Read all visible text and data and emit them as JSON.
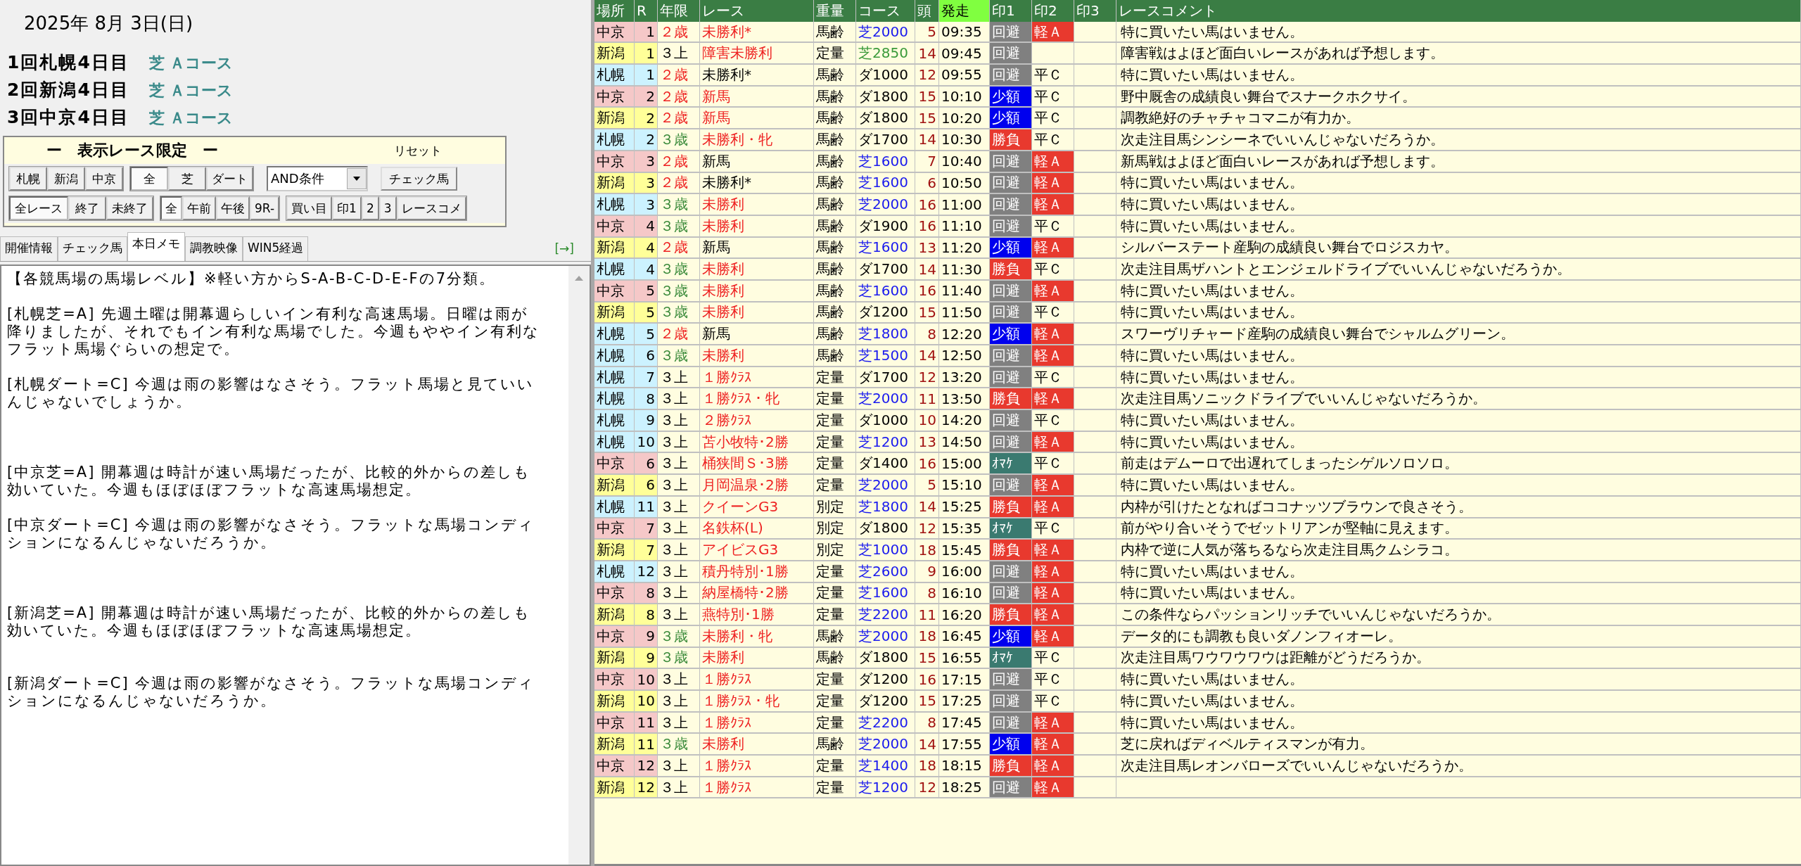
{
  "date": "2025年 8月 3日(日)",
  "meetings": [
    {
      "name": "1回札幌4日目",
      "course": "芝 Ａコース"
    },
    {
      "name": "2回新潟4日目",
      "course": "芝 Ａコース"
    },
    {
      "name": "3回中京4日目",
      "course": "芝 Ａコース"
    }
  ],
  "filter": {
    "title": "ー　表示レース限定　ー",
    "reset": "リセット",
    "venues": [
      {
        "label": "札幌",
        "selected": false
      },
      {
        "label": "新潟",
        "selected": false
      },
      {
        "label": "中京",
        "selected": false
      }
    ],
    "surfaces": [
      {
        "label": "全",
        "selected": true
      },
      {
        "label": "芝",
        "selected": false
      },
      {
        "label": "ダート",
        "selected": false
      }
    ],
    "condition": {
      "value": "AND条件"
    },
    "check_button": "チェック馬",
    "status": [
      {
        "label": "全レース",
        "selected": true
      },
      {
        "label": "終了",
        "selected": false
      },
      {
        "label": "未終了",
        "selected": false
      }
    ],
    "times": [
      {
        "label": "全",
        "selected": true
      },
      {
        "label": "午前",
        "selected": false
      },
      {
        "label": "午後",
        "selected": false
      },
      {
        "label": "9R-",
        "selected": false
      }
    ],
    "actions": [
      "買い目",
      "印1",
      "2",
      "3",
      "レースコメ"
    ]
  },
  "tabs": [
    {
      "label": "開催情報",
      "selected": false
    },
    {
      "label": "チェック馬",
      "selected": false
    },
    {
      "label": "本日メモ",
      "selected": true
    },
    {
      "label": "調教映像",
      "selected": false
    },
    {
      "label": "WIN5経過",
      "selected": false
    }
  ],
  "expand_link": "[→]",
  "memo": "【各競馬場の馬場レベル】※軽い方からS-A-B-C-D-E-Fの7分類。\n\n[札幌芝=A] 先週土曜は開幕週らしいイン有利な高速馬場。日曜は雨が降りましたが、それでもイン有利な馬場でした。今週もややイン有利なフラット馬場ぐらいの想定で。\n\n[札幌ダート=C] 今週は雨の影響はなさそう。フラット馬場と見ていいんじゃないでしょうか。\n\n\n\n[中京芝=A] 開幕週は時計が速い馬場だったが、比較的外からの差しも効いていた。今週もほぼほぼフラットな高速馬場想定。\n\n[中京ダート=C] 今週は雨の影響がなさそう。フラットな馬場コンディションになるんじゃないだろうか。\n\n\n\n[新潟芝=A] 開幕週は時計が速い馬場だったが、比較的外からの差しも効いていた。今週もほぼほぼフラットな高速馬場想定。\n\n\n[新潟ダート=C] 今週は雨の影響がなさそう。フラットな馬場コンディションになるんじゃないだろうか。",
  "table": {
    "columns": [
      "場所",
      "R",
      "年限",
      "レース",
      "重量",
      "コース",
      "頭",
      "発走",
      "印1",
      "印2",
      "印3",
      "レースコメント"
    ],
    "rows": [
      {
        "venue": "中京",
        "color": "#f5c8c8",
        "r": "1",
        "age": {
          "text": "２歳",
          "color": "#ee2222"
        },
        "race": {
          "text": "未勝利*",
          "color": "#ee2222"
        },
        "weight": "馬齢",
        "course": {
          "text": "芝2000",
          "color": "#1a1aee"
        },
        "heads": "5",
        "time": "09:35",
        "mark1": {
          "text": "回避",
          "color": "#808080"
        },
        "mark2": {
          "text": "軽Ａ",
          "color": "#e8392e"
        },
        "comment": "特に買いたい馬はいません。"
      },
      {
        "venue": "新潟",
        "color": "#ffff99",
        "r": "1",
        "age": {
          "text": "３上",
          "color": "#000000"
        },
        "race": {
          "text": "障害未勝利",
          "color": "#ee2222"
        },
        "weight": "定量",
        "course": {
          "text": "芝2850",
          "color": "#3a9a3a"
        },
        "heads": "14",
        "time": "09:45",
        "mark1": {
          "text": "回避",
          "color": "#808080"
        },
        "comment": "障害戦はよほど面白いレースがあれば予想します。"
      },
      {
        "venue": "札幌",
        "color": "#ccf2ff",
        "r": "1",
        "age": {
          "text": "２歳",
          "color": "#ee2222"
        },
        "race": {
          "text": "未勝利*",
          "color": "#000000"
        },
        "weight": "馬齢",
        "course": {
          "text": "ダ1000",
          "color": "#000000"
        },
        "heads": "12",
        "time": "09:55",
        "mark1": {
          "text": "回避",
          "color": "#808080"
        },
        "mark2": {
          "text": "平Ｃ"
        },
        "comment": "特に買いたい馬はいません。"
      },
      {
        "venue": "中京",
        "color": "#f5c8c8",
        "r": "2",
        "age": {
          "text": "２歳",
          "color": "#ee2222"
        },
        "race": {
          "text": "新馬",
          "color": "#ee2222"
        },
        "weight": "馬齢",
        "course": {
          "text": "ダ1800",
          "color": "#000000"
        },
        "heads": "15",
        "time": "10:10",
        "mark1": {
          "text": "少額",
          "color": "#0000ee"
        },
        "mark2": {
          "text": "平Ｃ"
        },
        "comment": "野中厩舎の成績良い舞台でスナークホクサイ。"
      },
      {
        "venue": "新潟",
        "color": "#ffff99",
        "r": "2",
        "age": {
          "text": "２歳",
          "color": "#ee2222"
        },
        "race": {
          "text": "新馬",
          "color": "#ee2222"
        },
        "weight": "馬齢",
        "course": {
          "text": "ダ1800",
          "color": "#000000"
        },
        "heads": "15",
        "time": "10:20",
        "mark1": {
          "text": "少額",
          "color": "#0000ee"
        },
        "mark2": {
          "text": "平Ｃ"
        },
        "comment": "調教絶好のチャチャコマニが有力か。"
      },
      {
        "venue": "札幌",
        "color": "#ccf2ff",
        "r": "2",
        "age": {
          "text": "３歳",
          "color": "#3a8a3a"
        },
        "race": {
          "text": "未勝利・牝",
          "color": "#ee2222"
        },
        "weight": "馬齢",
        "course": {
          "text": "ダ1700",
          "color": "#000000"
        },
        "heads": "14",
        "time": "10:30",
        "mark1": {
          "text": "勝負",
          "color": "#e8392e"
        },
        "mark2": {
          "text": "平Ｃ"
        },
        "comment": "次走注目馬シンシーネでいいんじゃないだろうか。"
      },
      {
        "venue": "中京",
        "color": "#f5c8c8",
        "r": "3",
        "age": {
          "text": "２歳",
          "color": "#ee2222"
        },
        "race": {
          "text": "新馬",
          "color": "#000000"
        },
        "weight": "馬齢",
        "course": {
          "text": "芝1600",
          "color": "#1a1aee"
        },
        "heads": "7",
        "time": "10:40",
        "mark1": {
          "text": "回避",
          "color": "#808080"
        },
        "mark2": {
          "text": "軽Ａ",
          "color": "#e8392e"
        },
        "comment": "新馬戦はよほど面白いレースがあれば予想します。"
      },
      {
        "venue": "新潟",
        "color": "#ffff99",
        "r": "3",
        "age": {
          "text": "２歳",
          "color": "#ee2222"
        },
        "race": {
          "text": "未勝利*",
          "color": "#000000"
        },
        "weight": "馬齢",
        "course": {
          "text": "芝1600",
          "color": "#1a1aee"
        },
        "heads": "6",
        "time": "10:50",
        "mark1": {
          "text": "回避",
          "color": "#808080"
        },
        "mark2": {
          "text": "軽Ａ",
          "color": "#e8392e"
        },
        "comment": "特に買いたい馬はいません。"
      },
      {
        "venue": "札幌",
        "color": "#ccf2ff",
        "r": "3",
        "age": {
          "text": "３歳",
          "color": "#3a8a3a"
        },
        "race": {
          "text": "未勝利",
          "color": "#ee2222"
        },
        "weight": "馬齢",
        "course": {
          "text": "芝2000",
          "color": "#1a1aee"
        },
        "heads": "16",
        "time": "11:00",
        "mark1": {
          "text": "回避",
          "color": "#808080"
        },
        "mark2": {
          "text": "軽Ａ",
          "color": "#e8392e"
        },
        "comment": "特に買いたい馬はいません。"
      },
      {
        "venue": "中京",
        "color": "#f5c8c8",
        "r": "4",
        "age": {
          "text": "３歳",
          "color": "#3a8a3a"
        },
        "race": {
          "text": "未勝利",
          "color": "#ee2222"
        },
        "weight": "馬齢",
        "course": {
          "text": "ダ1900",
          "color": "#000000"
        },
        "heads": "16",
        "time": "11:10",
        "mark1": {
          "text": "回避",
          "color": "#808080"
        },
        "mark2": {
          "text": "平Ｃ"
        },
        "comment": "特に買いたい馬はいません。"
      },
      {
        "venue": "新潟",
        "color": "#ffff99",
        "r": "4",
        "age": {
          "text": "２歳",
          "color": "#ee2222"
        },
        "race": {
          "text": "新馬",
          "color": "#000000"
        },
        "weight": "馬齢",
        "course": {
          "text": "芝1600",
          "color": "#1a1aee"
        },
        "heads": "13",
        "time": "11:20",
        "mark1": {
          "text": "少額",
          "color": "#0000ee"
        },
        "mark2": {
          "text": "軽Ａ",
          "color": "#e8392e"
        },
        "comment": "シルバーステート産駒の成績良い舞台でロジスカヤ。"
      },
      {
        "venue": "札幌",
        "color": "#ccf2ff",
        "r": "4",
        "age": {
          "text": "３歳",
          "color": "#3a8a3a"
        },
        "race": {
          "text": "未勝利",
          "color": "#ee2222"
        },
        "weight": "馬齢",
        "course": {
          "text": "ダ1700",
          "color": "#000000"
        },
        "heads": "14",
        "time": "11:30",
        "mark1": {
          "text": "勝負",
          "color": "#e8392e"
        },
        "mark2": {
          "text": "平Ｃ"
        },
        "comment": "次走注目馬ザハントとエンジェルドライブでいいんじゃないだろうか。"
      },
      {
        "venue": "中京",
        "color": "#f5c8c8",
        "r": "5",
        "age": {
          "text": "３歳",
          "color": "#3a8a3a"
        },
        "race": {
          "text": "未勝利",
          "color": "#ee2222"
        },
        "weight": "馬齢",
        "course": {
          "text": "芝1600",
          "color": "#1a1aee"
        },
        "heads": "16",
        "time": "11:40",
        "mark1": {
          "text": "回避",
          "color": "#808080"
        },
        "mark2": {
          "text": "軽Ａ",
          "color": "#e8392e"
        },
        "comment": "特に買いたい馬はいません。"
      },
      {
        "venue": "新潟",
        "color": "#ffff99",
        "r": "5",
        "age": {
          "text": "３歳",
          "color": "#3a8a3a"
        },
        "race": {
          "text": "未勝利",
          "color": "#ee2222"
        },
        "weight": "馬齢",
        "course": {
          "text": "ダ1200",
          "color": "#000000"
        },
        "heads": "15",
        "time": "11:50",
        "mark1": {
          "text": "回避",
          "color": "#808080"
        },
        "mark2": {
          "text": "平Ｃ"
        },
        "comment": "特に買いたい馬はいません。"
      },
      {
        "venue": "札幌",
        "color": "#ccf2ff",
        "r": "5",
        "age": {
          "text": "２歳",
          "color": "#ee2222"
        },
        "race": {
          "text": "新馬",
          "color": "#000000"
        },
        "weight": "馬齢",
        "course": {
          "text": "芝1800",
          "color": "#1a1aee"
        },
        "heads": "8",
        "time": "12:20",
        "mark1": {
          "text": "少額",
          "color": "#0000ee"
        },
        "mark2": {
          "text": "軽Ａ",
          "color": "#e8392e"
        },
        "comment": "スワーヴリチャード産駒の成績良い舞台でシャルムグリーン。"
      },
      {
        "venue": "札幌",
        "color": "#ccf2ff",
        "r": "6",
        "age": {
          "text": "３歳",
          "color": "#3a8a3a"
        },
        "race": {
          "text": "未勝利",
          "color": "#ee2222"
        },
        "weight": "馬齢",
        "course": {
          "text": "芝1500",
          "color": "#1a1aee"
        },
        "heads": "14",
        "time": "12:50",
        "mark1": {
          "text": "回避",
          "color": "#808080"
        },
        "mark2": {
          "text": "軽Ａ",
          "color": "#e8392e"
        },
        "comment": "特に買いたい馬はいません。"
      },
      {
        "venue": "札幌",
        "color": "#ccf2ff",
        "r": "7",
        "age": {
          "text": "３上",
          "color": "#000000"
        },
        "race": {
          "text": "１勝ｸﾗｽ",
          "color": "#ee2222"
        },
        "weight": "定量",
        "course": {
          "text": "ダ1700",
          "color": "#000000"
        },
        "heads": "12",
        "time": "13:20",
        "mark1": {
          "text": "回避",
          "color": "#808080"
        },
        "mark2": {
          "text": "平Ｃ"
        },
        "comment": "特に買いたい馬はいません。"
      },
      {
        "venue": "札幌",
        "color": "#ccf2ff",
        "r": "8",
        "age": {
          "text": "３上",
          "color": "#000000"
        },
        "race": {
          "text": "１勝ｸﾗｽ・牝",
          "color": "#ee2222"
        },
        "weight": "定量",
        "course": {
          "text": "芝2000",
          "color": "#1a1aee"
        },
        "heads": "11",
        "time": "13:50",
        "mark1": {
          "text": "勝負",
          "color": "#e8392e"
        },
        "mark2": {
          "text": "軽Ａ",
          "color": "#e8392e"
        },
        "comment": "次走注目馬ソニックドライブでいいんじゃないだろうか。"
      },
      {
        "venue": "札幌",
        "color": "#ccf2ff",
        "r": "9",
        "age": {
          "text": "３上",
          "color": "#000000"
        },
        "race": {
          "text": "２勝ｸﾗｽ",
          "color": "#ee2222"
        },
        "weight": "定量",
        "course": {
          "text": "ダ1000",
          "color": "#000000"
        },
        "heads": "10",
        "time": "14:20",
        "mark1": {
          "text": "回避",
          "color": "#808080"
        },
        "mark2": {
          "text": "平Ｃ"
        },
        "comment": "特に買いたい馬はいません。"
      },
      {
        "venue": "札幌",
        "color": "#ccf2ff",
        "r": "10",
        "age": {
          "text": "３上",
          "color": "#000000"
        },
        "race": {
          "text": "苫小牧特･2勝",
          "color": "#ee2222"
        },
        "weight": "定量",
        "course": {
          "text": "芝1200",
          "color": "#1a1aee"
        },
        "heads": "13",
        "time": "14:50",
        "mark1": {
          "text": "回避",
          "color": "#808080"
        },
        "mark2": {
          "text": "軽Ａ",
          "color": "#e8392e"
        },
        "comment": "特に買いたい馬はいません。"
      },
      {
        "venue": "中京",
        "color": "#f5c8c8",
        "r": "6",
        "age": {
          "text": "３上",
          "color": "#000000"
        },
        "race": {
          "text": "桶狭間Ｓ･3勝",
          "color": "#ee2222"
        },
        "weight": "定量",
        "course": {
          "text": "ダ1400",
          "color": "#000000"
        },
        "heads": "16",
        "time": "15:00",
        "mark1": {
          "text": "ｵﾏｹ",
          "color": "#3a7a70"
        },
        "mark2": {
          "text": "平Ｃ"
        },
        "comment": "前走はデムーロで出遅れてしまったシゲルソロソロ。"
      },
      {
        "venue": "新潟",
        "color": "#ffff99",
        "r": "6",
        "age": {
          "text": "３上",
          "color": "#000000"
        },
        "race": {
          "text": "月岡温泉･2勝",
          "color": "#ee2222"
        },
        "weight": "定量",
        "course": {
          "text": "芝2000",
          "color": "#1a1aee"
        },
        "heads": "5",
        "time": "15:10",
        "mark1": {
          "text": "回避",
          "color": "#808080"
        },
        "mark2": {
          "text": "軽Ａ",
          "color": "#e8392e"
        },
        "comment": "特に買いたい馬はいません。"
      },
      {
        "venue": "札幌",
        "color": "#ccf2ff",
        "r": "11",
        "age": {
          "text": "３上",
          "color": "#000000"
        },
        "race": {
          "text": "クイーンG3",
          "color": "#ee2222"
        },
        "weight": "別定",
        "course": {
          "text": "芝1800",
          "color": "#1a1aee"
        },
        "heads": "14",
        "time": "15:25",
        "mark1": {
          "text": "勝負",
          "color": "#e8392e"
        },
        "mark2": {
          "text": "軽Ａ",
          "color": "#e8392e"
        },
        "comment": "内枠が引けたとなればココナッツブラウンで良さそう。"
      },
      {
        "venue": "中京",
        "color": "#f5c8c8",
        "r": "7",
        "age": {
          "text": "３上",
          "color": "#000000"
        },
        "race": {
          "text": "名鉄杯(L)",
          "color": "#ee2222"
        },
        "weight": "別定",
        "course": {
          "text": "ダ1800",
          "color": "#000000"
        },
        "heads": "12",
        "time": "15:35",
        "mark1": {
          "text": "ｵﾏｹ",
          "color": "#3a7a70"
        },
        "mark2": {
          "text": "平Ｃ"
        },
        "comment": "前がやり合いそうでゼットリアンが堅軸に見えます。"
      },
      {
        "venue": "新潟",
        "color": "#ffff99",
        "r": "7",
        "age": {
          "text": "３上",
          "color": "#000000"
        },
        "race": {
          "text": "アイビスG3",
          "color": "#ee2222"
        },
        "weight": "別定",
        "course": {
          "text": "芝1000",
          "color": "#1a1aee"
        },
        "heads": "18",
        "time": "15:45",
        "mark1": {
          "text": "勝負",
          "color": "#e8392e"
        },
        "mark2": {
          "text": "軽Ａ",
          "color": "#e8392e"
        },
        "comment": "内枠で逆に人気が落ちるなら次走注目馬クムシラコ。"
      },
      {
        "venue": "札幌",
        "color": "#ccf2ff",
        "r": "12",
        "age": {
          "text": "３上",
          "color": "#000000"
        },
        "race": {
          "text": "積丹特別･1勝",
          "color": "#ee2222"
        },
        "weight": "定量",
        "course": {
          "text": "芝2600",
          "color": "#1a1aee"
        },
        "heads": "9",
        "time": "16:00",
        "mark1": {
          "text": "回避",
          "color": "#808080"
        },
        "mark2": {
          "text": "軽Ａ",
          "color": "#e8392e"
        },
        "comment": "特に買いたい馬はいません。"
      },
      {
        "venue": "中京",
        "color": "#f5c8c8",
        "r": "8",
        "age": {
          "text": "３上",
          "color": "#000000"
        },
        "race": {
          "text": "納屋橋特･2勝",
          "color": "#ee2222"
        },
        "weight": "定量",
        "course": {
          "text": "芝1600",
          "color": "#1a1aee"
        },
        "heads": "8",
        "time": "16:10",
        "mark1": {
          "text": "回避",
          "color": "#808080"
        },
        "mark2": {
          "text": "軽Ａ",
          "color": "#e8392e"
        },
        "comment": "特に買いたい馬はいません。"
      },
      {
        "venue": "新潟",
        "color": "#ffff99",
        "r": "8",
        "age": {
          "text": "３上",
          "color": "#000000"
        },
        "race": {
          "text": "燕特別･1勝",
          "color": "#ee2222"
        },
        "weight": "定量",
        "course": {
          "text": "芝2200",
          "color": "#1a1aee"
        },
        "heads": "11",
        "time": "16:20",
        "mark1": {
          "text": "勝負",
          "color": "#e8392e"
        },
        "mark2": {
          "text": "軽Ａ",
          "color": "#e8392e"
        },
        "comment": "この条件ならパッションリッチでいいんじゃないだろうか。"
      },
      {
        "venue": "中京",
        "color": "#f5c8c8",
        "r": "9",
        "age": {
          "text": "３歳",
          "color": "#3a8a3a"
        },
        "race": {
          "text": "未勝利・牝",
          "color": "#ee2222"
        },
        "weight": "馬齢",
        "course": {
          "text": "芝2000",
          "color": "#1a1aee"
        },
        "heads": "18",
        "time": "16:45",
        "mark1": {
          "text": "少額",
          "color": "#0000ee"
        },
        "mark2": {
          "text": "軽Ａ",
          "color": "#e8392e"
        },
        "comment": "データ的にも調教も良いダノンフィオーレ。"
      },
      {
        "venue": "新潟",
        "color": "#ffff99",
        "r": "9",
        "age": {
          "text": "３歳",
          "color": "#3a8a3a"
        },
        "race": {
          "text": "未勝利",
          "color": "#ee2222"
        },
        "weight": "馬齢",
        "course": {
          "text": "ダ1800",
          "color": "#000000"
        },
        "heads": "15",
        "time": "16:55",
        "mark1": {
          "text": "ｵﾏｹ",
          "color": "#3a7a70"
        },
        "mark2": {
          "text": "平Ｃ"
        },
        "comment": "次走注目馬ワウワウワウは距離がどうだろうか。"
      },
      {
        "venue": "中京",
        "color": "#f5c8c8",
        "r": "10",
        "age": {
          "text": "３上",
          "color": "#000000"
        },
        "race": {
          "text": "１勝ｸﾗｽ",
          "color": "#ee2222"
        },
        "weight": "定量",
        "course": {
          "text": "ダ1200",
          "color": "#000000"
        },
        "heads": "16",
        "time": "17:15",
        "mark1": {
          "text": "回避",
          "color": "#808080"
        },
        "mark2": {
          "text": "平Ｃ"
        },
        "comment": "特に買いたい馬はいません。"
      },
      {
        "venue": "新潟",
        "color": "#ffff99",
        "r": "10",
        "age": {
          "text": "３上",
          "color": "#000000"
        },
        "race": {
          "text": "１勝ｸﾗｽ・牝",
          "color": "#ee2222"
        },
        "weight": "定量",
        "course": {
          "text": "ダ1200",
          "color": "#000000"
        },
        "heads": "15",
        "time": "17:25",
        "mark1": {
          "text": "回避",
          "color": "#808080"
        },
        "mark2": {
          "text": "平Ｃ"
        },
        "comment": "特に買いたい馬はいません。"
      },
      {
        "venue": "中京",
        "color": "#f5c8c8",
        "r": "11",
        "age": {
          "text": "３上",
          "color": "#000000"
        },
        "race": {
          "text": "１勝ｸﾗｽ",
          "color": "#ee2222"
        },
        "weight": "定量",
        "course": {
          "text": "芝2200",
          "color": "#1a1aee"
        },
        "heads": "8",
        "time": "17:45",
        "mark1": {
          "text": "回避",
          "color": "#808080"
        },
        "mark2": {
          "text": "軽Ａ",
          "color": "#e8392e"
        },
        "comment": "特に買いたい馬はいません。"
      },
      {
        "venue": "新潟",
        "color": "#ffff99",
        "r": "11",
        "age": {
          "text": "３歳",
          "color": "#3a8a3a"
        },
        "race": {
          "text": "未勝利",
          "color": "#ee2222"
        },
        "weight": "馬齢",
        "course": {
          "text": "芝2000",
          "color": "#1a1aee"
        },
        "heads": "14",
        "time": "17:55",
        "mark1": {
          "text": "少額",
          "color": "#0000ee"
        },
        "mark2": {
          "text": "軽Ａ",
          "color": "#e8392e"
        },
        "comment": "芝に戻ればディベルティスマンが有力。"
      },
      {
        "venue": "中京",
        "color": "#f5c8c8",
        "r": "12",
        "age": {
          "text": "３上",
          "color": "#000000"
        },
        "race": {
          "text": "１勝ｸﾗｽ",
          "color": "#ee2222"
        },
        "weight": "定量",
        "course": {
          "text": "芝1400",
          "color": "#1a1aee"
        },
        "heads": "18",
        "time": "18:15",
        "mark1": {
          "text": "勝負",
          "color": "#e8392e"
        },
        "mark2": {
          "text": "軽Ａ",
          "color": "#e8392e"
        },
        "comment": "次走注目馬レオンバローズでいいんじゃないだろうか。"
      },
      {
        "venue": "新潟",
        "color": "#ffff99",
        "r": "12",
        "age": {
          "text": "３上",
          "color": "#000000"
        },
        "race": {
          "text": "１勝ｸﾗｽ",
          "color": "#ee2222"
        },
        "weight": "定量",
        "course": {
          "text": "芝1200",
          "color": "#1a1aee"
        },
        "heads": "12",
        "time": "18:25",
        "mark1": {
          "text": "回避",
          "color": "#808080"
        },
        "mark2": {
          "text": "軽Ａ",
          "color": "#e8392e"
        }
      }
    ]
  }
}
